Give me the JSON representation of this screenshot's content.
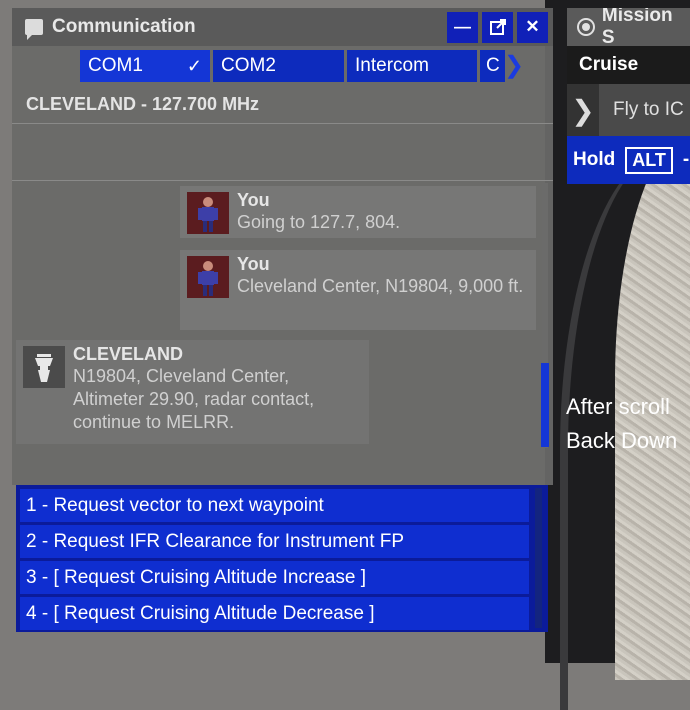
{
  "communication": {
    "title": "Communication",
    "tabs": [
      {
        "label": "COM1",
        "active": true
      },
      {
        "label": "COM2",
        "active": false
      },
      {
        "label": "Intercom",
        "active": false
      },
      {
        "label": "C",
        "active": false
      }
    ],
    "frequency": "CLEVELAND - 127.700 MHz",
    "messages": [
      {
        "sender": "You",
        "text": "Going to 127.7, 804."
      },
      {
        "sender": "You",
        "text": "Cleveland Center, N19804, 9,000 ft."
      },
      {
        "sender": "CLEVELAND",
        "text": "N19804, Cleveland Center, Altimeter 29.90, radar contact, continue to MELRR."
      }
    ]
  },
  "options": [
    "1 - Request vector to next waypoint",
    "2 - Request IFR Clearance for Instrument FP",
    "3 - [ Request Cruising Altitude Increase ]",
    "4 - [ Request Cruising Altitude Decrease ]"
  ],
  "mission": {
    "title": "Mission S",
    "phase": "Cruise",
    "instruction": "Fly to IC",
    "hold_label": "Hold",
    "alt_badge": "ALT",
    "hold_extra": "-"
  },
  "annotation": {
    "line1": "After scroll",
    "line2": "Back Down"
  },
  "colors": {
    "accent": "#0f2ed0",
    "panel": "#696968"
  }
}
